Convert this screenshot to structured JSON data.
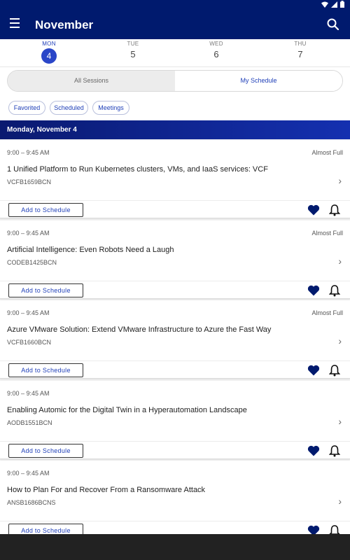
{
  "colors": {
    "brand": "#001a6e",
    "accent": "#2a46c8",
    "heart": "#001a6e"
  },
  "status_bar": {
    "icons": [
      "wifi-icon",
      "signal-icon",
      "battery-icon"
    ]
  },
  "app_bar": {
    "title": "November",
    "icons": [
      "menu-icon",
      "search-icon"
    ]
  },
  "day_tabs": [
    {
      "dow": "MON",
      "num": "4",
      "active": true
    },
    {
      "dow": "TUE",
      "num": "5",
      "active": false
    },
    {
      "dow": "WED",
      "num": "6",
      "active": false
    },
    {
      "dow": "THU",
      "num": "7",
      "active": false
    }
  ],
  "segments": {
    "all": "All Sessions",
    "mine": "My Schedule",
    "selected": "My Schedule"
  },
  "filters": [
    "Favorited",
    "Scheduled",
    "Meetings"
  ],
  "day_header": "Monday, November 4",
  "sessions": [
    {
      "time": "9:00 – 9:45 AM",
      "availability": "Almost Full",
      "title": "1 Unified Platform to Run Kubernetes clusters, VMs, and IaaS services: VCF",
      "code": "VCFB1659BCN",
      "button": "Add to Schedule",
      "favorited": true
    },
    {
      "time": "9:00 – 9:45 AM",
      "availability": "Almost Full",
      "title": "Artificial Intelligence: Even Robots Need a Laugh",
      "code": "CODEB1425BCN",
      "button": "Add to Schedule",
      "favorited": true
    },
    {
      "time": "9:00 – 9:45 AM",
      "availability": "Almost Full",
      "title": "Azure VMware Solution: Extend VMware Infrastructure to Azure the Fast Way",
      "code": "VCFB1660BCN",
      "button": "Add to Schedule",
      "favorited": true
    },
    {
      "time": "9:00 – 9:45 AM",
      "availability": "",
      "title": "Enabling Automic for the Digital Twin in a Hyperautomation Landscape",
      "code": "AODB1551BCN",
      "button": "Add to Schedule",
      "favorited": true
    },
    {
      "time": "9:00 – 9:45 AM",
      "availability": "",
      "title": "How to Plan For and Recover From a Ransomware Attack",
      "code": "ANSB1686BCNS",
      "button": "Add to Schedule",
      "favorited": true
    }
  ]
}
